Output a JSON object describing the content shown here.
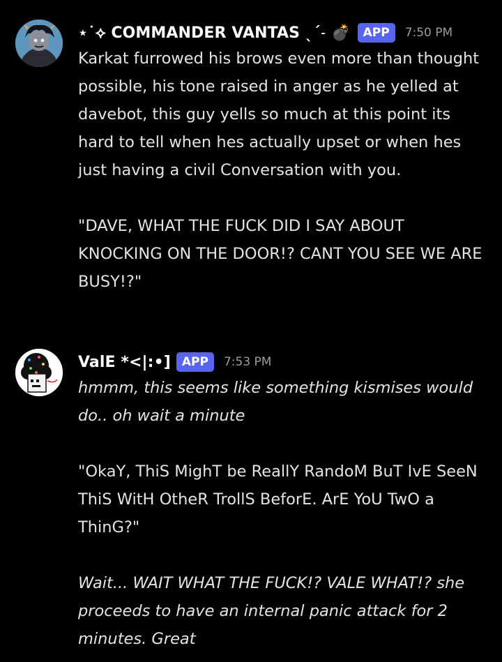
{
  "messages": [
    {
      "author": "⋆˙⟡ COMMANDER VANTAS ˎˊ˗ 💣",
      "badge": "APP",
      "time": "7:50 PM",
      "para1": "Karkat furrowed his brows even more than thought possible, his tone raised in anger as he yelled at davebot, this guy yells so much at this point its hard to tell when hes actually upset or when hes just having a civil Conversation with you.",
      "para2": "\"DAVE, WHAT THE FUCK DID I SAY ABOUT KNOCKING ON THE DOOR!? CANT YOU SEE WE ARE BUSY!?\""
    },
    {
      "author": "ValE *<|:•]",
      "badge": "APP",
      "time": "7:53 PM",
      "para1": "hmmm, this seems like something kismises would do.. oh wait a minute",
      "para2": "\"OkaY, ThiS MighT be ReallY RandoM BuT IvE SeeN ThiS WitH OtheR TrollS BeforE. ArE YoU TwO a ThinG?\"",
      "para3": "Wait... WAIT WHAT THE FUCK!? VALE WHAT!? she proceeds to have an internal panic attack for 2 minutes. Great"
    }
  ]
}
